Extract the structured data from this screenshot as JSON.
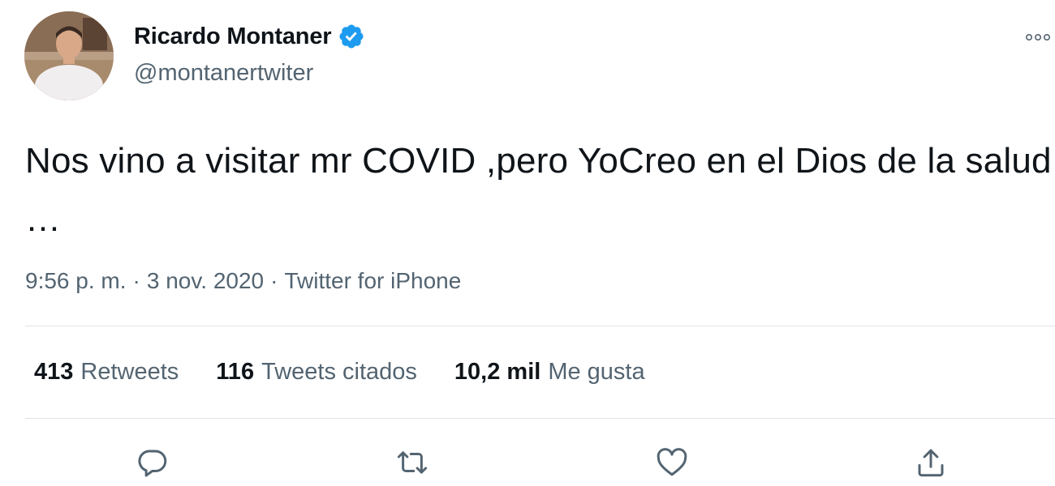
{
  "author": {
    "name": "Ricardo Montaner",
    "handle": "@montanertwiter",
    "verified": true
  },
  "tweet": {
    "text": "Nos vino a visitar mr COVID ,pero YoCreo en el Dios de la salud …",
    "time": "9:56 p. m.",
    "date": "3 nov. 2020",
    "separator": "·",
    "source": "Twitter for iPhone"
  },
  "stats": {
    "retweets": {
      "count": "413",
      "label": "Retweets"
    },
    "quotes": {
      "count": "116",
      "label": "Tweets citados"
    },
    "likes": {
      "count": "10,2 mil",
      "label": "Me gusta"
    }
  },
  "icons": {
    "verified": "verified-badge-icon",
    "more": "more-options-icon",
    "reply": "reply-icon",
    "retweet": "retweet-icon",
    "like": "heart-icon",
    "share": "share-icon"
  },
  "colors": {
    "accent": "#1d9bf0",
    "text_primary": "#0f1419",
    "text_secondary": "#536471",
    "divider": "#dfe3e6"
  }
}
